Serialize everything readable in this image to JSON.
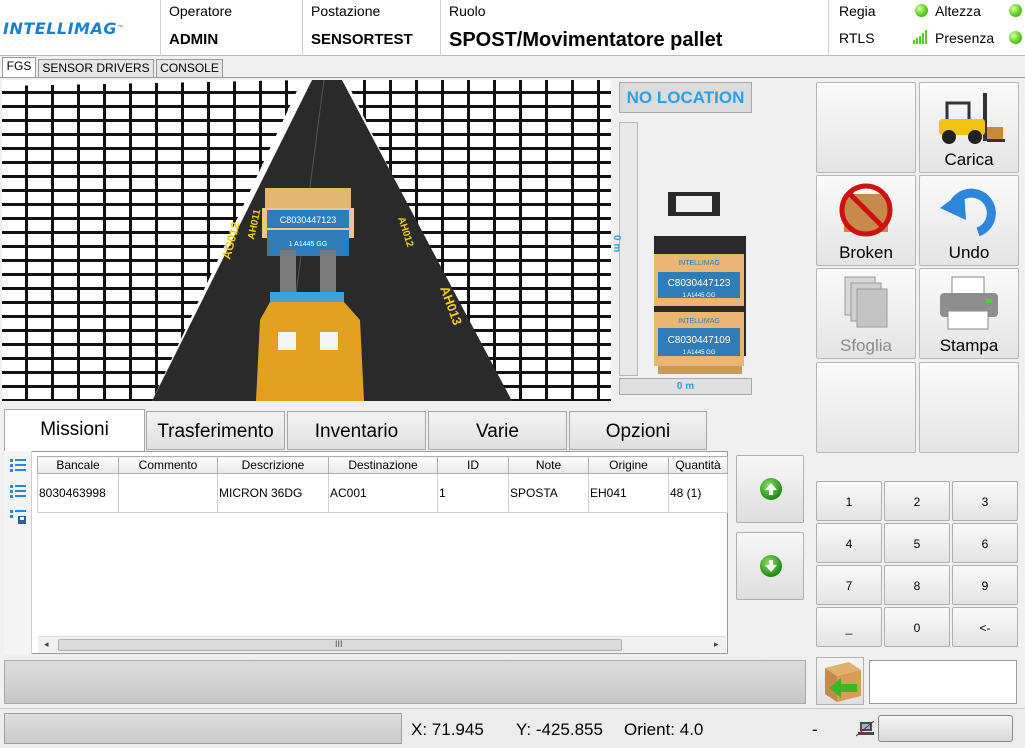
{
  "header": {
    "logo_text": "INTELLIMAG",
    "logo_tm": "™",
    "operatore_label": "Operatore",
    "operatore_value": "ADMIN",
    "postazione_label": "Postazione",
    "postazione_value": "SENSORTEST",
    "ruolo_label": "Ruolo",
    "ruolo_value": "SPOST/Movimentatore pallet",
    "status": {
      "regia": "Regia",
      "rtls": "RTLS",
      "altezza": "Altezza",
      "presenza": "Presenza"
    }
  },
  "top_tabs": [
    "FGS",
    "SENSOR DRIVERS",
    "CONSOLE"
  ],
  "view3d": {
    "aisle_labels": [
      "AG012",
      "AH011",
      "AH012",
      "AH013"
    ],
    "pallet_code": "C8030447123",
    "pallet_sub": "1 A1445 GG"
  },
  "forklift_panel": {
    "location": "NO LOCATION",
    "height_label": "0 m",
    "floor_label": "0 m",
    "brand": "INTELLIMAG",
    "pallets": [
      {
        "code": "C8030447123",
        "sub": "1 A1445 GG"
      },
      {
        "code": "C8030447109",
        "sub": "1 A1445 GG"
      }
    ]
  },
  "actions": {
    "carica": "Carica",
    "broken": "Broken",
    "undo": "Undo",
    "sfoglia": "Sfoglia",
    "stampa": "Stampa"
  },
  "bottom_tabs": [
    "Missioni",
    "Trasferimento",
    "Inventario",
    "Varie",
    "Opzioni"
  ],
  "table": {
    "columns": [
      "Bancale",
      "Commento",
      "Descrizione",
      "Destinazione",
      "ID",
      "Note",
      "Origine",
      "Quantità"
    ],
    "rows": [
      [
        "8030463998",
        "",
        "MICRON 36DG",
        "AC001",
        "1",
        "SPOSTA",
        "EH041",
        "48 (1)"
      ]
    ],
    "scroll_thumb_label": "III"
  },
  "keypad": [
    "1",
    "2",
    "3",
    "4",
    "5",
    "6",
    "7",
    "8",
    "9",
    "_",
    "0",
    "<-"
  ],
  "statusbar": {
    "x": "X: 71.945",
    "y": "Y: -425.855",
    "orient": "Orient: 4.0",
    "dash": "-"
  },
  "colors": {
    "accent_blue": "#2b9ff0",
    "logo_blue": "#1d7fc7",
    "status_green": "#5ccd1c",
    "forklift_orange": "#e3a020"
  }
}
